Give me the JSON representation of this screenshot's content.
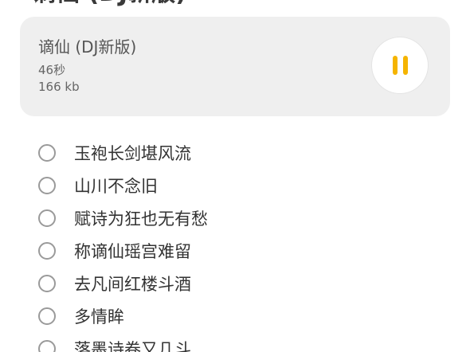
{
  "page": {
    "title": "谪仙 (DJ新版)"
  },
  "player": {
    "track_title": "谪仙 (DJ新版)",
    "duration": "46秒",
    "size": "166 kb",
    "state": "playing",
    "control_icon": "pause-icon",
    "accent_color": "#f5b400"
  },
  "lyrics": [
    "玉袍长剑堪风流",
    "山川不念旧",
    "赋诗为狂也无有愁",
    "称谪仙瑶宫难留",
    "去凡间红楼斗酒",
    "多情眸",
    "落墨诗卷又几斗"
  ]
}
